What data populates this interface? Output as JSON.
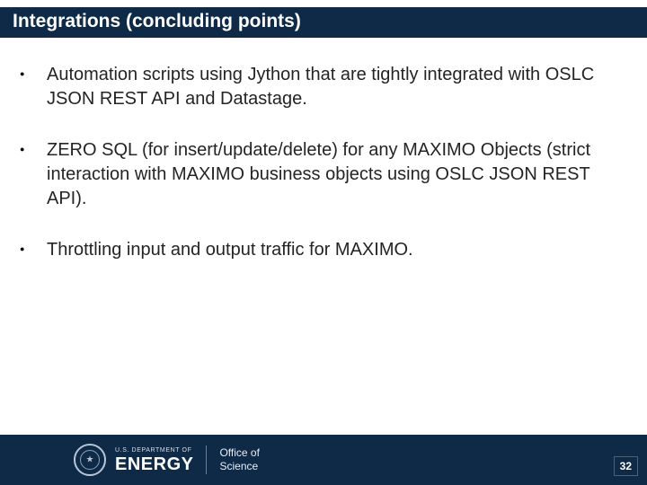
{
  "title": "Integrations (concluding points)",
  "bullets": [
    "Automation scripts using Jython that are tightly integrated with OSLC JSON REST API  and Datastage.",
    "ZERO SQL (for insert/update/delete) for any MAXIMO Objects (strict interaction with MAXIMO business objects using OSLC JSON REST API).",
    "Throttling input and output traffic for MAXIMO."
  ],
  "footer": {
    "dept_top": "U.S. DEPARTMENT OF",
    "dept_main": "ENERGY",
    "office_line1": "Office of",
    "office_line2": "Science",
    "page": "32"
  }
}
